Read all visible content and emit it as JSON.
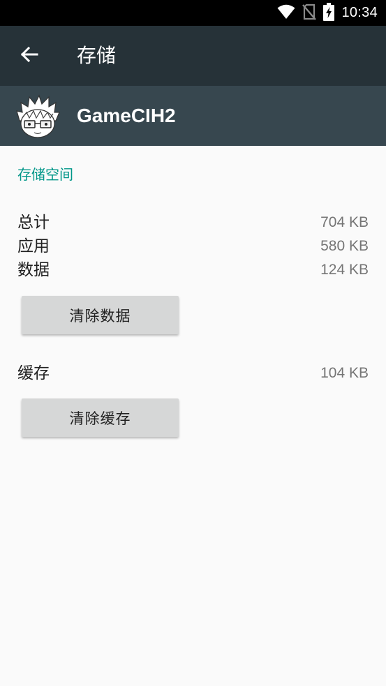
{
  "status_bar": {
    "time": "10:34",
    "icons": [
      "wifi-icon",
      "no-sim-icon",
      "battery-charging-icon"
    ]
  },
  "toolbar": {
    "title": "存储",
    "back_icon": "arrow-back-icon"
  },
  "app": {
    "name": "GameCIH2",
    "icon": "anime-character-avatar-icon"
  },
  "storage": {
    "section_title": "存储空间",
    "total_label": "总计",
    "total_value": "704 KB",
    "app_label": "应用",
    "app_value": "580 KB",
    "data_label": "数据",
    "data_value": "124 KB",
    "clear_data_label": "清除数据",
    "cache_label": "缓存",
    "cache_value": "104 KB",
    "clear_cache_label": "清除缓存"
  },
  "colors": {
    "status_bar": "#000000",
    "toolbar": "#263238",
    "app_header": "#37474f",
    "accent": "#009688",
    "background": "#fafafa",
    "button": "#d6d7d7"
  }
}
